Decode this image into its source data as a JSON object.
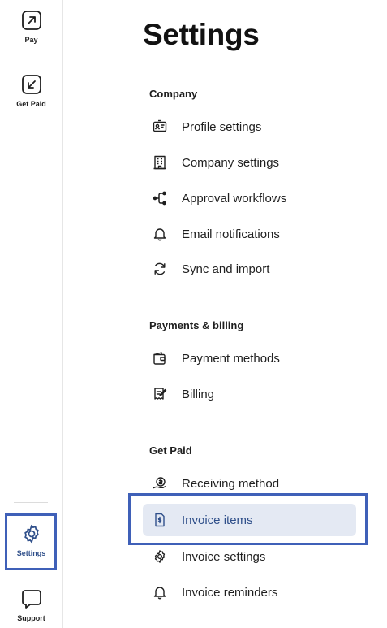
{
  "rail": {
    "items": [
      {
        "label": "Pay",
        "icon": "arrow-up-right-icon"
      },
      {
        "label": "Get Paid",
        "icon": "arrow-down-left-icon"
      },
      {
        "label": "Settings",
        "icon": "gear-icon",
        "active": true
      },
      {
        "label": "Support",
        "icon": "chat-bubble-icon"
      }
    ]
  },
  "page": {
    "title": "Settings"
  },
  "sections": [
    {
      "heading": "Company",
      "items": [
        {
          "label": "Profile settings",
          "icon": "id-card-icon"
        },
        {
          "label": "Company settings",
          "icon": "building-icon"
        },
        {
          "label": "Approval workflows",
          "icon": "workflow-icon"
        },
        {
          "label": "Email notifications",
          "icon": "bell-icon"
        },
        {
          "label": "Sync and import",
          "icon": "sync-icon"
        }
      ]
    },
    {
      "heading": "Payments & billing",
      "items": [
        {
          "label": "Payment methods",
          "icon": "wallet-icon"
        },
        {
          "label": "Billing",
          "icon": "receipt-pen-icon"
        }
      ]
    },
    {
      "heading": "Get Paid",
      "items": [
        {
          "label": "Receiving method",
          "icon": "hand-coin-icon"
        },
        {
          "label": "Invoice items",
          "icon": "invoice-dollar-icon",
          "selected": true
        },
        {
          "label": "Invoice settings",
          "icon": "gear-icon"
        },
        {
          "label": "Invoice reminders",
          "icon": "bell-icon"
        }
      ]
    }
  ],
  "colors": {
    "highlight_border": "#3f60b8",
    "selected_background": "#e4e9f3",
    "selected_text": "#2f4f8a"
  }
}
